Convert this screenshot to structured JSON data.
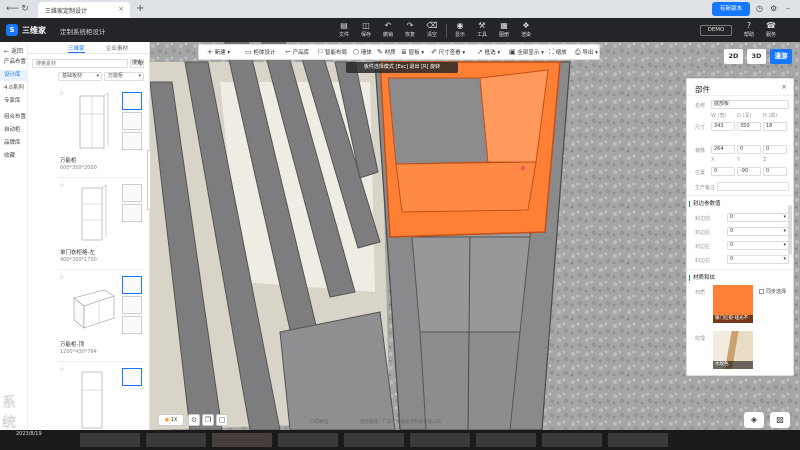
{
  "browser": {
    "tab_title": "三维家定制设计",
    "update_button": "有新版本"
  },
  "header": {
    "brand": "三维家",
    "subtitle": "定制系统柜设计",
    "buttons": [
      {
        "icon": "file-icon",
        "label": "文件"
      },
      {
        "icon": "save-icon",
        "label": "保存"
      },
      {
        "icon": "undo-icon",
        "label": "撤销"
      },
      {
        "icon": "redo-icon",
        "label": "恢复"
      },
      {
        "icon": "clear-icon",
        "label": "清空"
      },
      {
        "icon": "view-icon",
        "label": "显示"
      },
      {
        "icon": "tool-icon",
        "label": "工具"
      },
      {
        "icon": "gallery-icon",
        "label": "图册"
      },
      {
        "icon": "render-icon",
        "label": "渲染"
      }
    ],
    "right_buttons": [
      {
        "icon": "help-icon",
        "label": "帮助"
      },
      {
        "icon": "service-icon",
        "label": "服务"
      }
    ],
    "account": "DEMO"
  },
  "left_nav": {
    "back": "返回",
    "items": [
      "产品布置",
      "设计库",
      "4.0系列",
      "专家库",
      "组合布置",
      "自动柜",
      "品牌库",
      "收藏"
    ]
  },
  "left_panel": {
    "tabs": [
      "三维家",
      "企业素材"
    ],
    "search_placeholder": "搜索素材",
    "search_button": "搜索",
    "filter1": "基础板材",
    "filter2": "万能柜",
    "cards": [
      {
        "name": "万能柜",
        "dims": "600*350*2000"
      },
      {
        "name": "单门衣柜格-左",
        "dims": "400*300*1700"
      },
      {
        "name": "万能柜-顶",
        "dims": "1200*430*764"
      },
      {
        "name": "",
        "dims": ""
      }
    ],
    "watermark": "系统"
  },
  "toolbar": {
    "items": [
      {
        "icon": "plus-icon",
        "label": "新建"
      },
      {
        "icon": "design-icon",
        "label": "柜体设计"
      },
      {
        "icon": "product-icon",
        "label": "产品库"
      },
      {
        "icon": "smart-icon",
        "label": "智能布局"
      },
      {
        "icon": "wall-icon",
        "label": "墙体"
      },
      {
        "icon": "material-icon",
        "label": "材质"
      },
      {
        "icon": "board-icon",
        "label": "层板"
      },
      {
        "icon": "measure-icon",
        "label": "尺寸查看"
      },
      {
        "icon": "select-icon",
        "label": "框选"
      },
      {
        "icon": "all-icon",
        "label": "全部显示"
      },
      {
        "icon": "fit-icon",
        "label": "缩放"
      },
      {
        "icon": "export-icon",
        "label": "导出"
      }
    ],
    "hint": "板件选择模式 [Esc] 退出 [R] 旋转"
  },
  "view_modes": [
    "2D",
    "3D",
    "漫游"
  ],
  "properties": {
    "title": "部件",
    "name_label": "名称",
    "name_value": "底部板",
    "size_label": "尺寸",
    "w_label": "W (宽)",
    "d_label": "D (深)",
    "h_label": "H (高)",
    "w": "343",
    "d": "350",
    "h": "18",
    "offset_label": "偏移",
    "offset_values": [
      "264",
      "0",
      "0"
    ],
    "pos_label": "位置",
    "x_label": "X",
    "y_label": "Y",
    "z_label": "Z",
    "pos_values": [
      "0",
      "-90",
      "0"
    ],
    "note_label": "生产备注",
    "edge_section": "封边参数值",
    "edge_rows": [
      {
        "label": "封边前",
        "value": "0"
      },
      {
        "label": "封边后",
        "value": "0"
      },
      {
        "label": "封边左",
        "value": "0"
      },
      {
        "label": "封边右",
        "value": "0"
      }
    ],
    "material_section": "材质和纹",
    "material_label": "材质",
    "material_swatch": "#ff7f35",
    "material_name": "暖门红橙-哑光不",
    "same_check": "同步选择",
    "texture_label": "纹理",
    "texture_name": "木纹色"
  },
  "bottom": {
    "speed": "1X",
    "note_left": "CAD模型",
    "note_right": "保存路径：广东三维家信息科技有限公司"
  },
  "taskbar": {
    "time": "2023/8/19"
  },
  "colors": {
    "accent": "#1677ff",
    "highlight": "#ff7f35",
    "dark_header": "#232529"
  }
}
